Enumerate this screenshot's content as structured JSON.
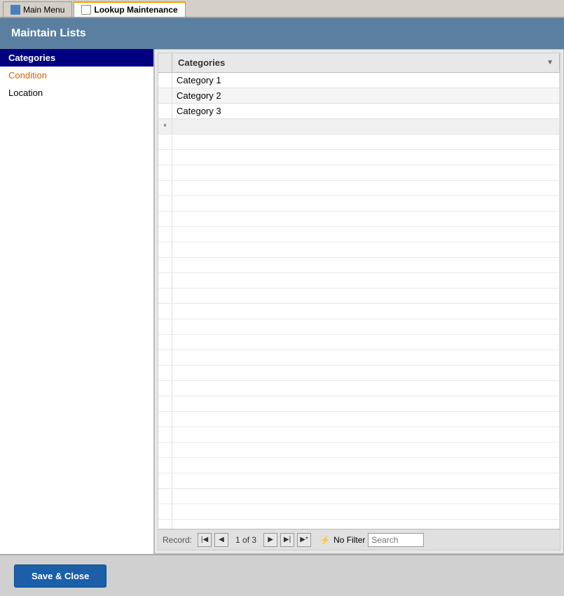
{
  "tabs": [
    {
      "id": "main-menu",
      "label": "Main Menu",
      "active": false
    },
    {
      "id": "lookup-maintenance",
      "label": "Lookup Maintenance",
      "active": true
    }
  ],
  "title": "Maintain Lists",
  "sidebar": {
    "items": [
      {
        "id": "categories",
        "label": "Categories",
        "selected": true
      },
      {
        "id": "condition",
        "label": "Condition",
        "orange": true
      },
      {
        "id": "location",
        "label": "Location",
        "orange": false
      }
    ]
  },
  "grid": {
    "column_header": "Categories",
    "rows": [
      {
        "value": "Category 1"
      },
      {
        "value": "Category 2"
      },
      {
        "value": "Category 3"
      }
    ],
    "new_row_marker": "*"
  },
  "navigation": {
    "record_label": "Record:",
    "record_info": "1 of 3",
    "filter_label": "No Filter",
    "search_placeholder": "Search"
  },
  "buttons": {
    "save_close": "Save & Close"
  }
}
